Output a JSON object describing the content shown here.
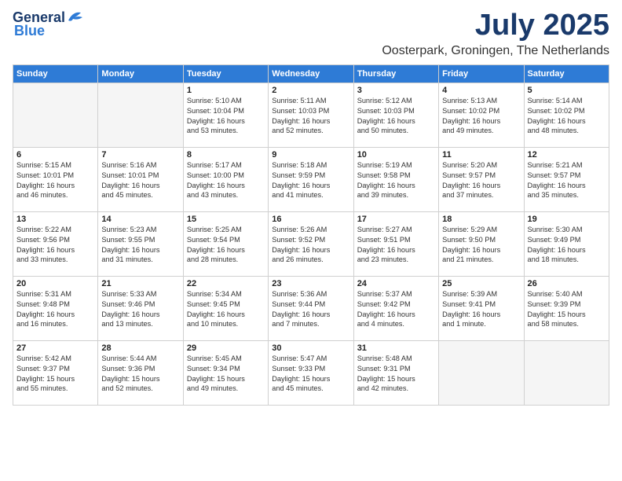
{
  "header": {
    "logo_general": "General",
    "logo_blue": "Blue",
    "month_title": "July 2025",
    "location": "Oosterpark, Groningen, The Netherlands"
  },
  "days_of_week": [
    "Sunday",
    "Monday",
    "Tuesday",
    "Wednesday",
    "Thursday",
    "Friday",
    "Saturday"
  ],
  "weeks": [
    [
      {
        "day": "",
        "info": ""
      },
      {
        "day": "",
        "info": ""
      },
      {
        "day": "1",
        "info": "Sunrise: 5:10 AM\nSunset: 10:04 PM\nDaylight: 16 hours\nand 53 minutes."
      },
      {
        "day": "2",
        "info": "Sunrise: 5:11 AM\nSunset: 10:03 PM\nDaylight: 16 hours\nand 52 minutes."
      },
      {
        "day": "3",
        "info": "Sunrise: 5:12 AM\nSunset: 10:03 PM\nDaylight: 16 hours\nand 50 minutes."
      },
      {
        "day": "4",
        "info": "Sunrise: 5:13 AM\nSunset: 10:02 PM\nDaylight: 16 hours\nand 49 minutes."
      },
      {
        "day": "5",
        "info": "Sunrise: 5:14 AM\nSunset: 10:02 PM\nDaylight: 16 hours\nand 48 minutes."
      }
    ],
    [
      {
        "day": "6",
        "info": "Sunrise: 5:15 AM\nSunset: 10:01 PM\nDaylight: 16 hours\nand 46 minutes."
      },
      {
        "day": "7",
        "info": "Sunrise: 5:16 AM\nSunset: 10:01 PM\nDaylight: 16 hours\nand 45 minutes."
      },
      {
        "day": "8",
        "info": "Sunrise: 5:17 AM\nSunset: 10:00 PM\nDaylight: 16 hours\nand 43 minutes."
      },
      {
        "day": "9",
        "info": "Sunrise: 5:18 AM\nSunset: 9:59 PM\nDaylight: 16 hours\nand 41 minutes."
      },
      {
        "day": "10",
        "info": "Sunrise: 5:19 AM\nSunset: 9:58 PM\nDaylight: 16 hours\nand 39 minutes."
      },
      {
        "day": "11",
        "info": "Sunrise: 5:20 AM\nSunset: 9:57 PM\nDaylight: 16 hours\nand 37 minutes."
      },
      {
        "day": "12",
        "info": "Sunrise: 5:21 AM\nSunset: 9:57 PM\nDaylight: 16 hours\nand 35 minutes."
      }
    ],
    [
      {
        "day": "13",
        "info": "Sunrise: 5:22 AM\nSunset: 9:56 PM\nDaylight: 16 hours\nand 33 minutes."
      },
      {
        "day": "14",
        "info": "Sunrise: 5:23 AM\nSunset: 9:55 PM\nDaylight: 16 hours\nand 31 minutes."
      },
      {
        "day": "15",
        "info": "Sunrise: 5:25 AM\nSunset: 9:54 PM\nDaylight: 16 hours\nand 28 minutes."
      },
      {
        "day": "16",
        "info": "Sunrise: 5:26 AM\nSunset: 9:52 PM\nDaylight: 16 hours\nand 26 minutes."
      },
      {
        "day": "17",
        "info": "Sunrise: 5:27 AM\nSunset: 9:51 PM\nDaylight: 16 hours\nand 23 minutes."
      },
      {
        "day": "18",
        "info": "Sunrise: 5:29 AM\nSunset: 9:50 PM\nDaylight: 16 hours\nand 21 minutes."
      },
      {
        "day": "19",
        "info": "Sunrise: 5:30 AM\nSunset: 9:49 PM\nDaylight: 16 hours\nand 18 minutes."
      }
    ],
    [
      {
        "day": "20",
        "info": "Sunrise: 5:31 AM\nSunset: 9:48 PM\nDaylight: 16 hours\nand 16 minutes."
      },
      {
        "day": "21",
        "info": "Sunrise: 5:33 AM\nSunset: 9:46 PM\nDaylight: 16 hours\nand 13 minutes."
      },
      {
        "day": "22",
        "info": "Sunrise: 5:34 AM\nSunset: 9:45 PM\nDaylight: 16 hours\nand 10 minutes."
      },
      {
        "day": "23",
        "info": "Sunrise: 5:36 AM\nSunset: 9:44 PM\nDaylight: 16 hours\nand 7 minutes."
      },
      {
        "day": "24",
        "info": "Sunrise: 5:37 AM\nSunset: 9:42 PM\nDaylight: 16 hours\nand 4 minutes."
      },
      {
        "day": "25",
        "info": "Sunrise: 5:39 AM\nSunset: 9:41 PM\nDaylight: 16 hours\nand 1 minute."
      },
      {
        "day": "26",
        "info": "Sunrise: 5:40 AM\nSunset: 9:39 PM\nDaylight: 15 hours\nand 58 minutes."
      }
    ],
    [
      {
        "day": "27",
        "info": "Sunrise: 5:42 AM\nSunset: 9:37 PM\nDaylight: 15 hours\nand 55 minutes."
      },
      {
        "day": "28",
        "info": "Sunrise: 5:44 AM\nSunset: 9:36 PM\nDaylight: 15 hours\nand 52 minutes."
      },
      {
        "day": "29",
        "info": "Sunrise: 5:45 AM\nSunset: 9:34 PM\nDaylight: 15 hours\nand 49 minutes."
      },
      {
        "day": "30",
        "info": "Sunrise: 5:47 AM\nSunset: 9:33 PM\nDaylight: 15 hours\nand 45 minutes."
      },
      {
        "day": "31",
        "info": "Sunrise: 5:48 AM\nSunset: 9:31 PM\nDaylight: 15 hours\nand 42 minutes."
      },
      {
        "day": "",
        "info": ""
      },
      {
        "day": "",
        "info": ""
      }
    ]
  ]
}
